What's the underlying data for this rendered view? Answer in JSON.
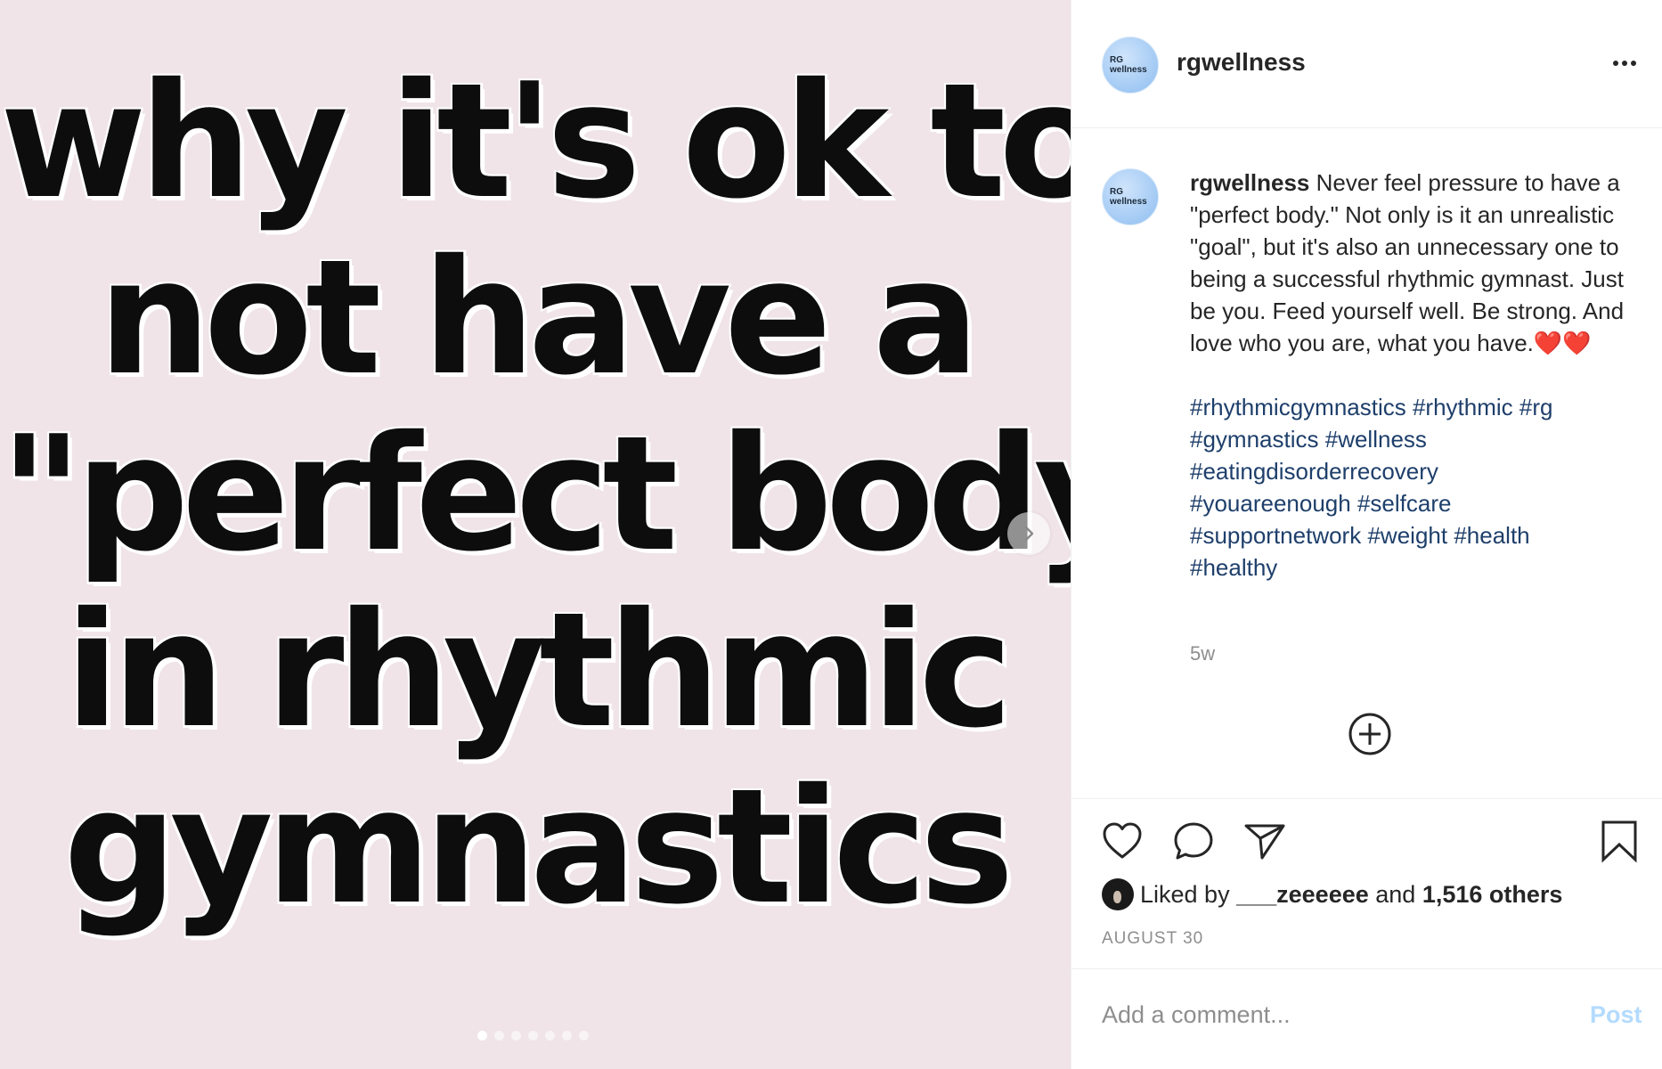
{
  "media": {
    "slide_lines": [
      "why it's ok to",
      "not have a",
      "\"perfect body\"",
      "in rhythmic",
      "gymnastics"
    ],
    "next_icon": "chevron-right-icon",
    "carousel": {
      "count": 7,
      "active_index": 0
    },
    "background_color": "#f0e4e8"
  },
  "header": {
    "avatar_text": [
      "RG",
      "wellness"
    ],
    "username": "rgwellness",
    "more_icon": "more-horizontal-icon"
  },
  "caption": {
    "username": "rgwellness",
    "text": "Never feel pressure to have a \"perfect body.\" Not only is it an unrealistic \"goal\", but it's also an unnecessary one to being a successful rhythmic gymnast. Just be you. Feed yourself well. Be strong. And love who you are, what you have.",
    "emoji": "❤️❤️",
    "hashtags": [
      "#rhythmicgymnastics",
      "#rhythmic",
      "#rg",
      "#gymnastics",
      "#wellness",
      "#eatingdisorderrecovery",
      "#youareenough",
      "#selfcare",
      "#supportnetwork",
      "#weight",
      "#health",
      "#healthy"
    ],
    "time_ago": "5w",
    "add_icon": "add-circle-icon"
  },
  "actions": {
    "icons": [
      "heart-icon",
      "comment-icon",
      "share-icon",
      "bookmark-icon"
    ],
    "liked_by_prefix": "Liked by",
    "liked_by_user": "___zeeeeee",
    "and_text": "and",
    "others_text": "1,516 others",
    "date": "AUGUST 30"
  },
  "comment": {
    "placeholder": "Add a comment...",
    "post_label": "Post"
  },
  "colors": {
    "hashtag": "#1e3f6b",
    "heart_emoji": "#e0242f",
    "post_button_disabled": "#b3dbff",
    "muted_text": "#8e8e8e"
  }
}
